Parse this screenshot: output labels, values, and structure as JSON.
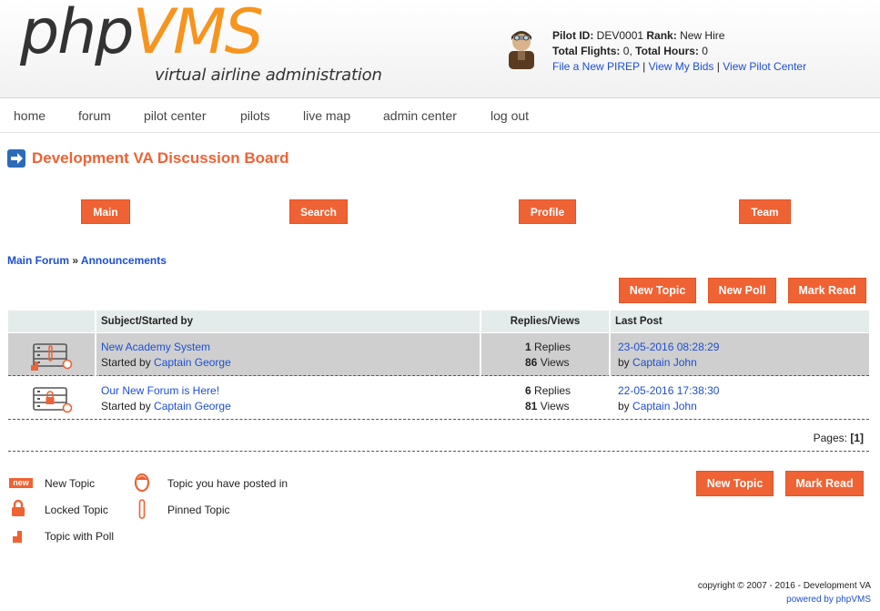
{
  "header": {
    "logo_php": "php",
    "logo_vms": "VMS",
    "logo_subtitle": "virtual airline administration",
    "pilot_id_label": "Pilot ID:",
    "pilot_id": "DEV0001",
    "rank_label": "Rank:",
    "rank": "New Hire",
    "flights_label": "Total Flights:",
    "flights": "0",
    "hours_label": "Total Hours:",
    "hours": "0",
    "links": [
      "File a New PIREP",
      "View My Bids",
      "View Pilot Center"
    ],
    "link_sep": "|"
  },
  "nav": [
    "home",
    "forum",
    "pilot center",
    "pilots",
    "live map",
    "admin center",
    "log out"
  ],
  "board_title": "Development VA Discussion Board",
  "forum_tabs": [
    "Main",
    "Search",
    "Profile",
    "Team"
  ],
  "breadcrumb": {
    "root": "Main Forum",
    "sep": "»",
    "current": "Announcements"
  },
  "actions": {
    "new_topic": "New Topic",
    "new_poll": "New Poll",
    "mark_read": "Mark Read"
  },
  "table": {
    "headers": [
      "Subject/Started by",
      "Replies/Views",
      "Last Post"
    ],
    "started_by_label": "Started by",
    "replies_label": "Replies",
    "views_label": "Views",
    "by_label": "by",
    "rows": [
      {
        "subject": "New Academy System",
        "author": "Captain George",
        "replies": "1",
        "views": "86",
        "last_date": "23-05-2016 08:28:29",
        "last_by": "Captain John",
        "icon": "pinned-topic-icon"
      },
      {
        "subject": "Our New Forum is Here!",
        "author": "Captain George",
        "replies": "6",
        "views": "81",
        "last_date": "22-05-2016 17:38:30",
        "last_by": "Captain John",
        "icon": "locked-topic-icon"
      }
    ]
  },
  "pages": {
    "label": "Pages:",
    "current": "[1]"
  },
  "legend": {
    "new_badge": "new",
    "new_topic": "New Topic",
    "posted_in": "Topic you have posted in",
    "locked": "Locked Topic",
    "pinned": "Pinned Topic",
    "poll": "Topic with Poll"
  },
  "bottom_actions": {
    "new_topic": "New Topic",
    "mark_read": "Mark Read"
  },
  "footer": {
    "copyright": "copyright © 2007 - 2016 - Development VA",
    "powered": "powered by phpVMS"
  },
  "colors": {
    "accent": "#ef6234",
    "link": "#1d4fd1",
    "logo_orange": "#f7941d",
    "row_gray": "#cfcfcf",
    "header_bg": "#e3ecea"
  }
}
